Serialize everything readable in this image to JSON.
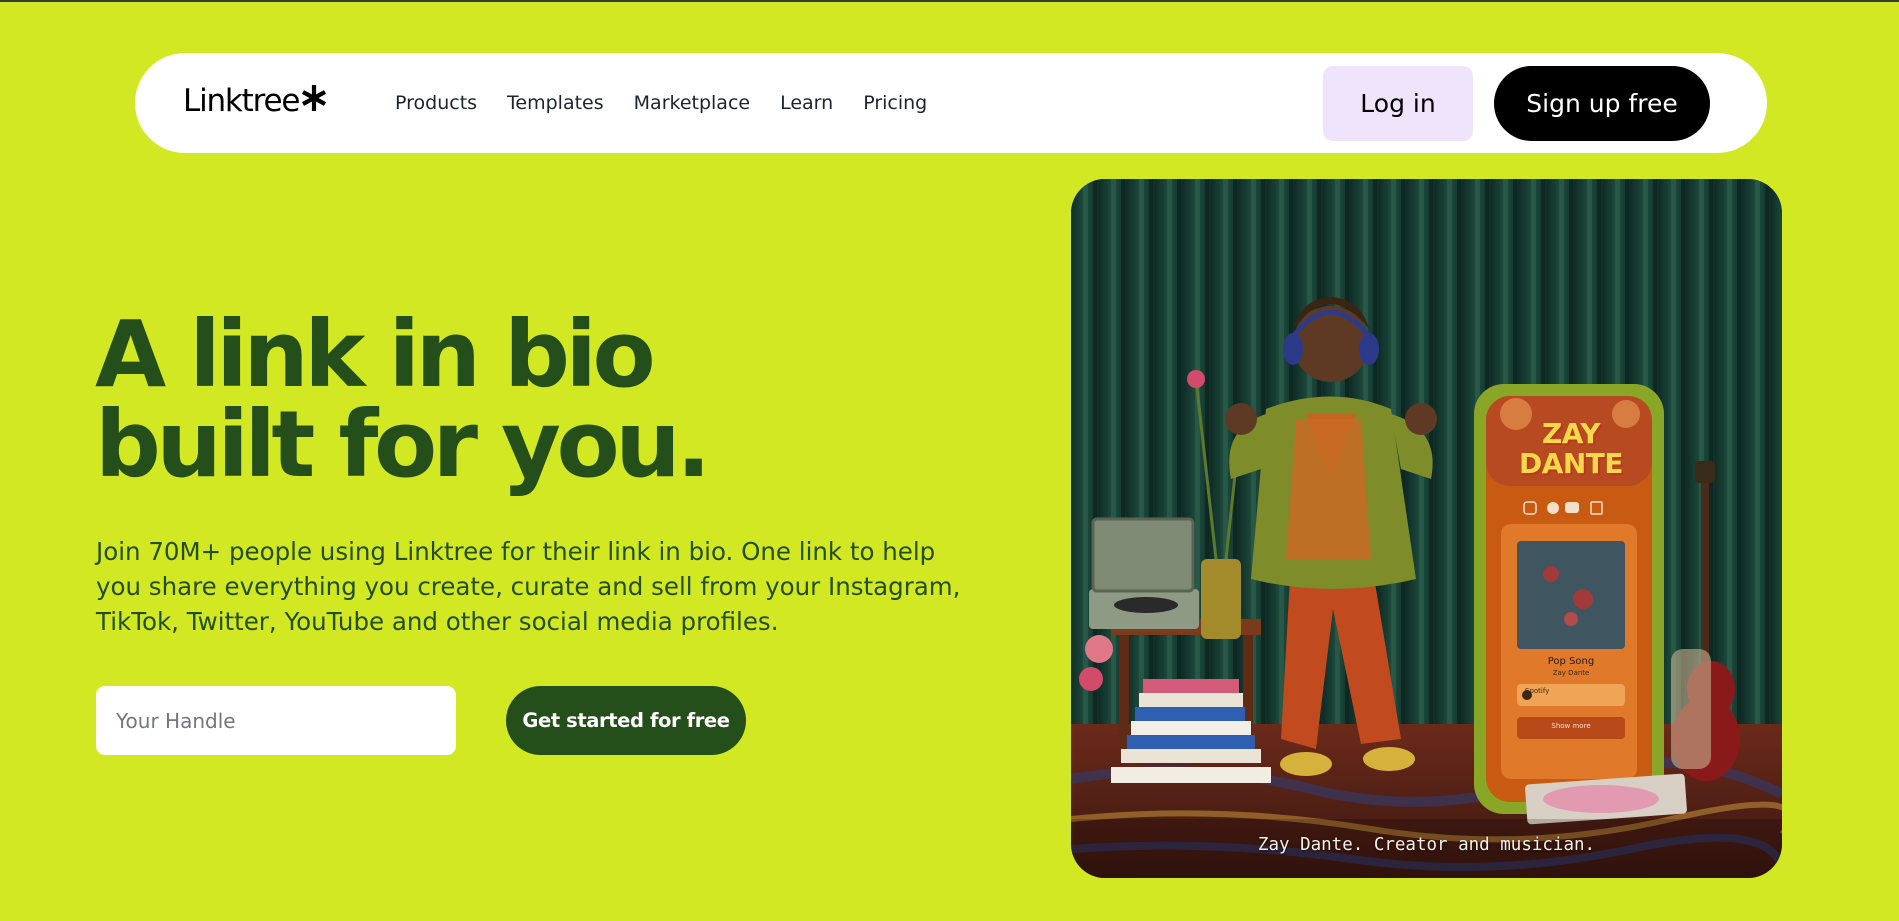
{
  "brand": {
    "name": "Linktree",
    "accent": "#d2e823",
    "dark_green": "#254f1a"
  },
  "nav": {
    "links": [
      "Products",
      "Templates",
      "Marketplace",
      "Learn",
      "Pricing"
    ],
    "login_label": "Log in",
    "signup_label": "Sign up free"
  },
  "hero": {
    "title_line1": "A link in bio",
    "title_line2": "built for you.",
    "description": "Join 70M+ people using Linktree for their link in bio. One link to help you share everything you create, curate and sell from your Instagram, TikTok, Twitter, YouTube and other social media profiles.",
    "handle_placeholder": "Your Handle",
    "cta_label": "Get started for free"
  },
  "media": {
    "caption": "Zay Dante. Creator and musician.",
    "phone": {
      "name_line1": "ZAY",
      "name_line2": "DANTE",
      "song_title": "Pop Song",
      "song_artist": "Zay Dante",
      "link_label": "Spotify",
      "show_more": "Show more",
      "icons": [
        "instagram-icon",
        "spotify-icon",
        "youtube-icon",
        "twitch-icon"
      ]
    }
  }
}
